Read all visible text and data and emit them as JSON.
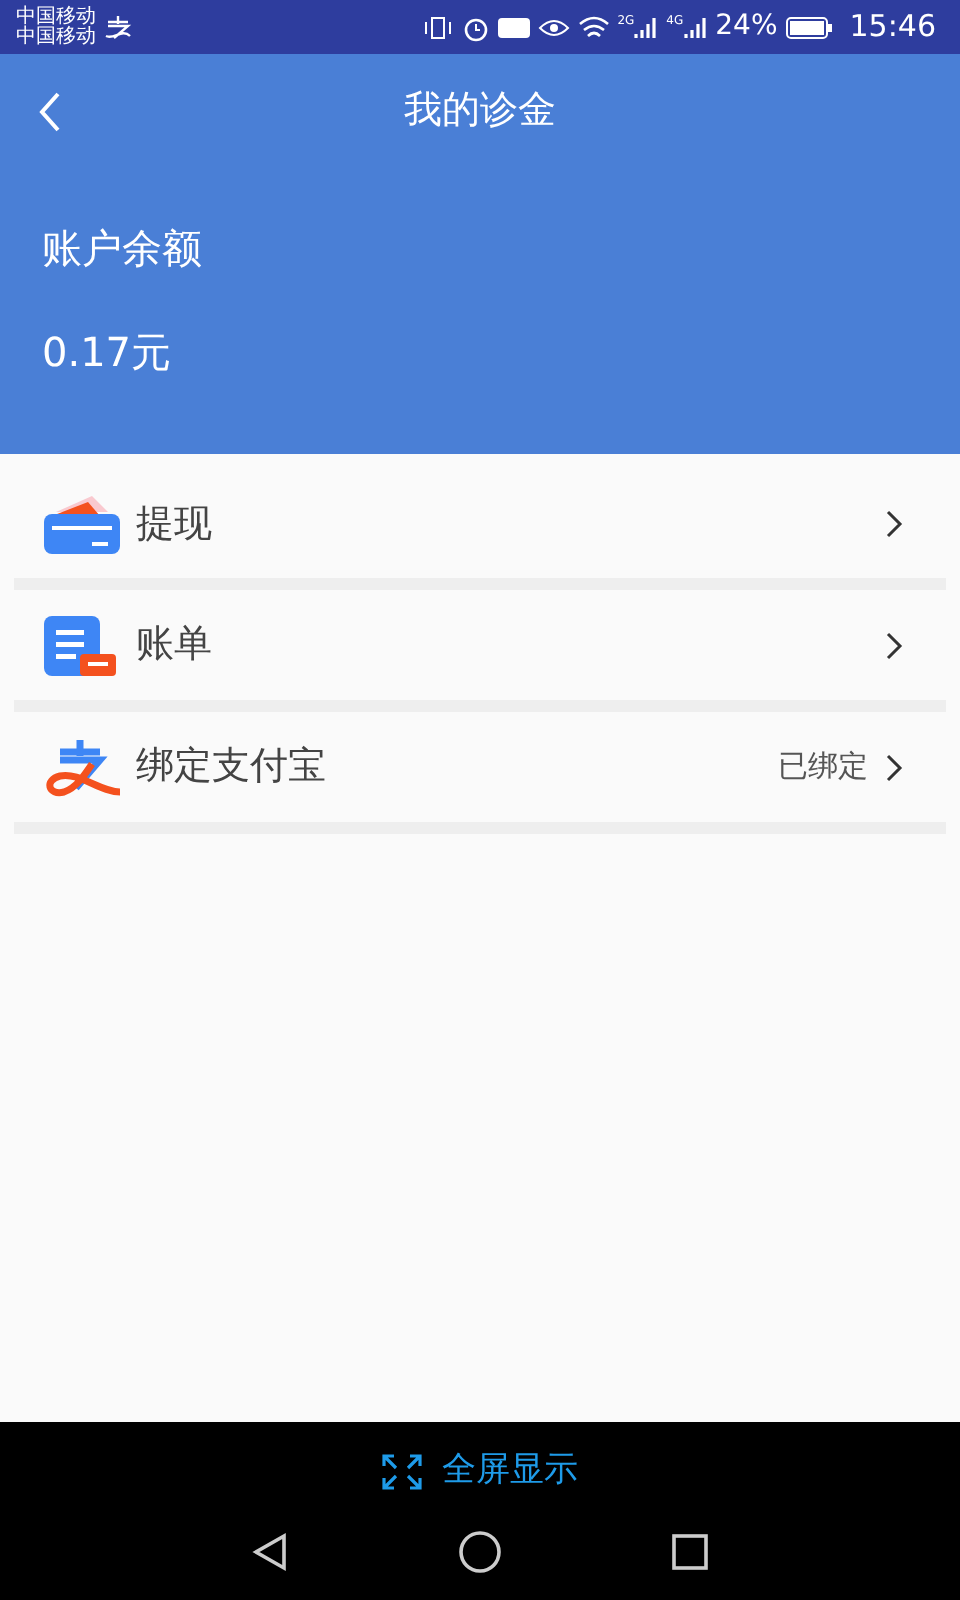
{
  "status_bar": {
    "carriers": [
      "中国移动",
      "中国移动"
    ],
    "signal_labels": [
      "2G",
      "4G"
    ],
    "battery": "24%",
    "time": "15:46"
  },
  "header": {
    "title": "我的诊金",
    "balance_label": "账户余额",
    "balance": "0.17元"
  },
  "menu": [
    {
      "kind": "withdraw",
      "label": "提现"
    },
    {
      "kind": "bill",
      "label": "账单"
    },
    {
      "kind": "alipay",
      "label": "绑定支付宝",
      "value": "已绑定"
    }
  ],
  "bottom_bar": {
    "fullscreen": "全屏显示"
  }
}
